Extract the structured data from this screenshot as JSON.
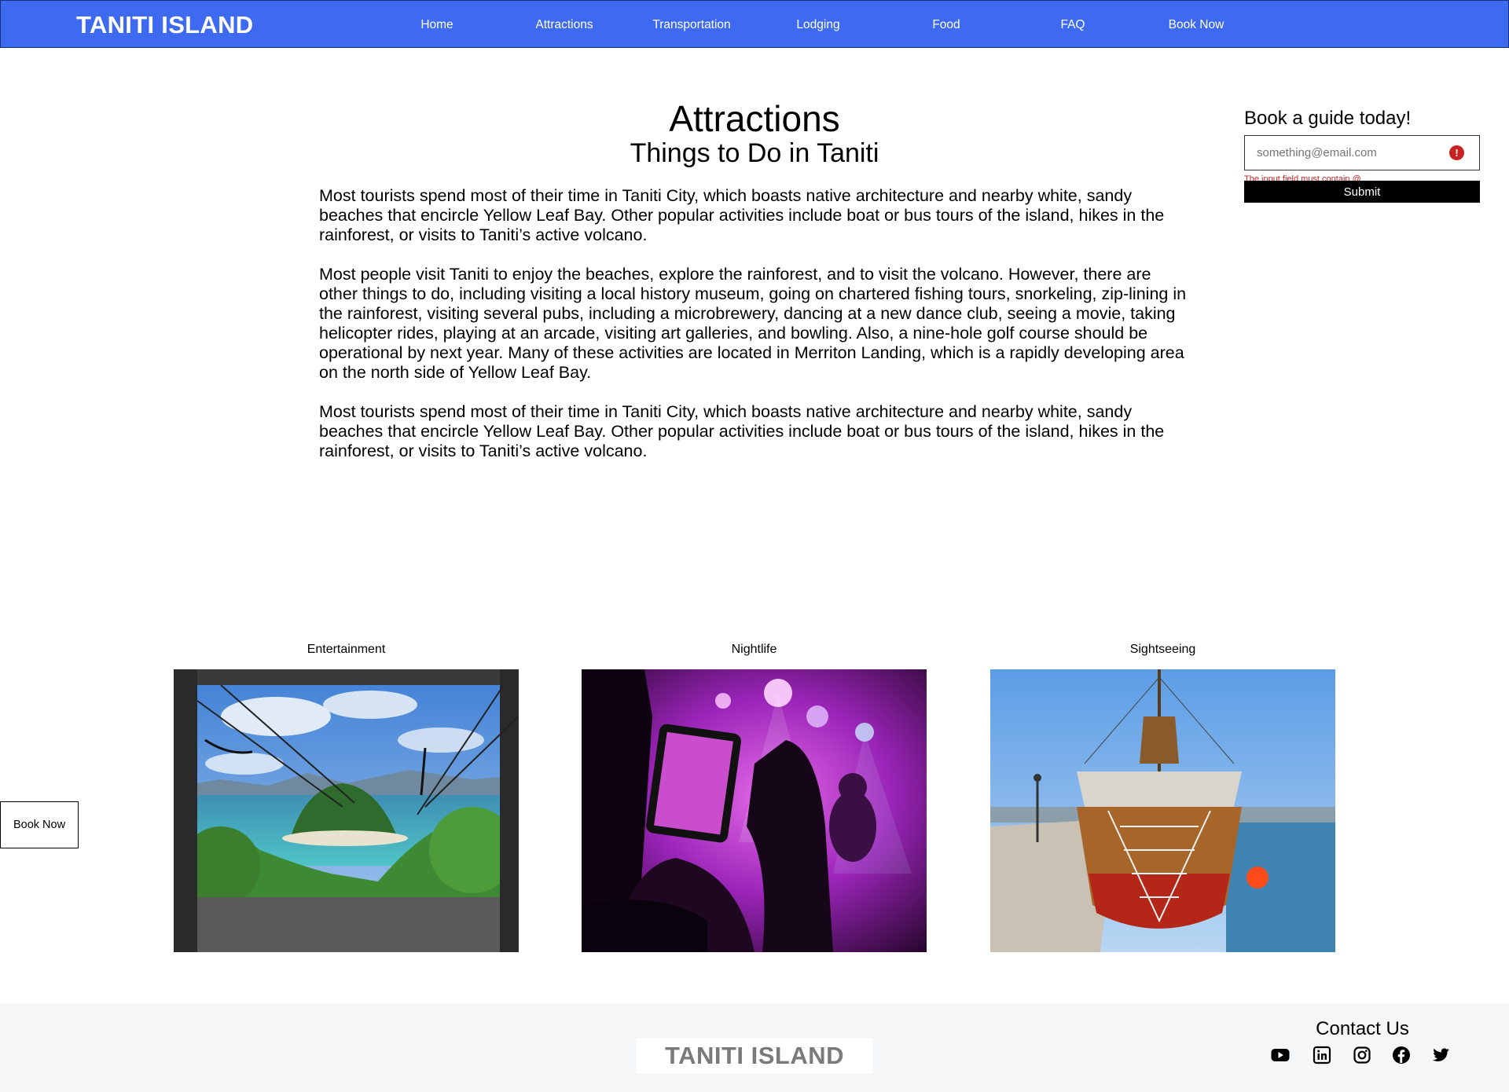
{
  "header": {
    "brand": "TANITI ISLAND",
    "nav": [
      {
        "label": "Home"
      },
      {
        "label": "Attractions"
      },
      {
        "label": "Transportation"
      },
      {
        "label": "Lodging"
      },
      {
        "label": "Food"
      },
      {
        "label": "FAQ"
      },
      {
        "label": "Book Now"
      }
    ]
  },
  "main": {
    "title": "Attractions",
    "subtitle": "Things to Do in Taniti",
    "paragraphs": [
      "Most tourists spend most of their time in Taniti City, which boasts native architecture and nearby white, sandy beaches that encircle Yellow Leaf Bay. Other popular activities include boat or bus tours of the island, hikes in the rainforest, or visits to Taniti’s active volcano.",
      "Most people visit Taniti to enjoy the beaches, explore the rainforest, and to visit the volcano. However, there are other things to do, including visiting a local history museum, going on chartered fishing tours, snorkeling, zip-lining in the rainforest, visiting several pubs, including a microbrewery, dancing at a new dance club, seeing a movie, taking helicopter rides, playing at an arcade, visiting art galleries, and bowling. Also, a nine-hole golf course should be operational by next year. Many of these activities are located in Merriton Landing, which is a rapidly developing area on the north side of Yellow Leaf Bay.",
      "Most tourists spend most of their time in Taniti City, which boasts native architecture and nearby white, sandy beaches that encircle Yellow Leaf Bay. Other popular activities include boat or bus tours of the island, hikes in the rainforest, or visits to Taniti’s active volcano."
    ]
  },
  "booking": {
    "title": "Book a guide today!",
    "email_placeholder": "something@email.com",
    "error": "The input field must contain @",
    "submit_label": "Submit"
  },
  "gallery": [
    {
      "label": "Entertainment"
    },
    {
      "label": "Nightlife"
    },
    {
      "label": "Sightseeing"
    }
  ],
  "float_button": {
    "label": "Book Now"
  },
  "footer": {
    "brand": "TANITI ISLAND",
    "contact_title": "Contact Us",
    "social": [
      "youtube-icon",
      "linkedin-icon",
      "instagram-icon",
      "facebook-icon",
      "twitter-icon"
    ]
  },
  "colors": {
    "navbar": "#3d6af0",
    "error": "#c92121",
    "footer_bg": "#f5f6f8"
  }
}
